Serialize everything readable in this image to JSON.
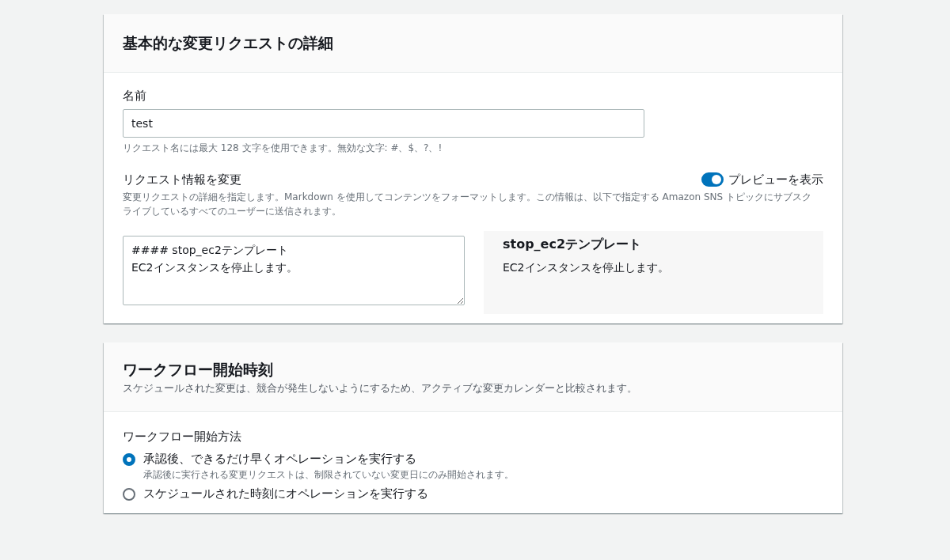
{
  "details": {
    "title": "基本的な変更リクエストの詳細",
    "name_field": {
      "label": "名前",
      "value": "test",
      "hint": "リクエスト名には最大 128 文字を使用できます。無効な文字: #、$、?、!"
    },
    "info_field": {
      "label": "リクエスト情報を変更",
      "toggle": {
        "label": "プレビューを表示",
        "on": true
      },
      "description": "変更リクエストの詳細を指定します。Markdown を使用してコンテンツをフォーマットします。この情報は、以下で指定する Amazon SNS トピックにサブスクライブしているすべてのユーザーに送信されます。",
      "value": "#### stop_ec2テンプレート\nEC2インスタンスを停止します。",
      "preview": {
        "heading": "stop_ec2テンプレート",
        "text": "EC2インスタンスを停止します。"
      }
    }
  },
  "workflow": {
    "title": "ワークフロー開始時刻",
    "subtitle": "スケジュールされた変更は、競合が発生しないようにするため、アクティブな変更カレンダーと比較されます。",
    "method_label": "ワークフロー開始方法",
    "options": [
      {
        "label": "承認後、できるだけ早くオペレーションを実行する",
        "hint": "承認後に実行される変更リクエストは、制限されていない変更日にのみ開始されます。",
        "selected": true
      },
      {
        "label": "スケジュールされた時刻にオペレーションを実行する",
        "selected": false
      }
    ]
  }
}
